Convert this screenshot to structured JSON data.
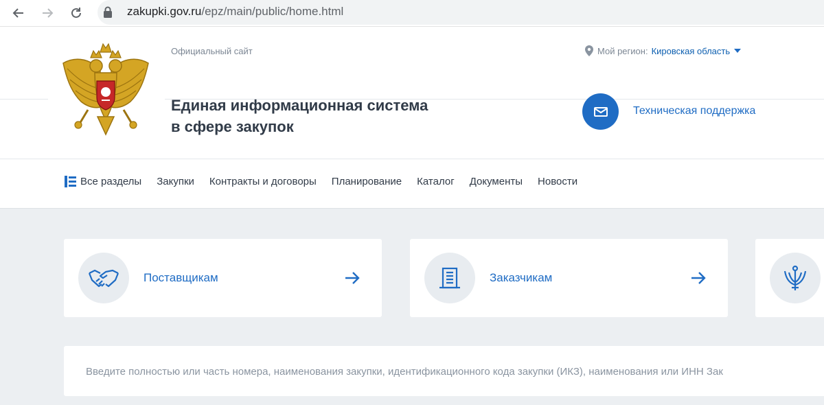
{
  "browser": {
    "url_domain": "zakupki.gov.ru",
    "url_path": "/epz/main/public/home.html"
  },
  "header": {
    "official_label": "Официальный сайт",
    "region_label": "Мой регион:",
    "region_value": "Кировская область",
    "title_line1": "Единая информационная система",
    "title_line2": "в сфере закупок",
    "support_label": "Техническая поддержка"
  },
  "menu": {
    "all_sections": "Все разделы",
    "items": [
      "Закупки",
      "Контракты и договоры",
      "Планирование",
      "Каталог",
      "Документы",
      "Новости"
    ]
  },
  "cards": [
    {
      "label": "Поставщикам",
      "icon": "handshake-icon"
    },
    {
      "label": "Заказчикам",
      "icon": "document-building-icon"
    },
    {
      "label": "",
      "icon": "emblem-shield-icon"
    }
  ],
  "search": {
    "placeholder": "Введите полностью или часть номера, наименования закупки, идентификационного кода закупки (ИКЗ), наименования или ИНН Зак"
  },
  "colors": {
    "accent": "#1f6cc4",
    "background_gray": "#eceff2"
  }
}
